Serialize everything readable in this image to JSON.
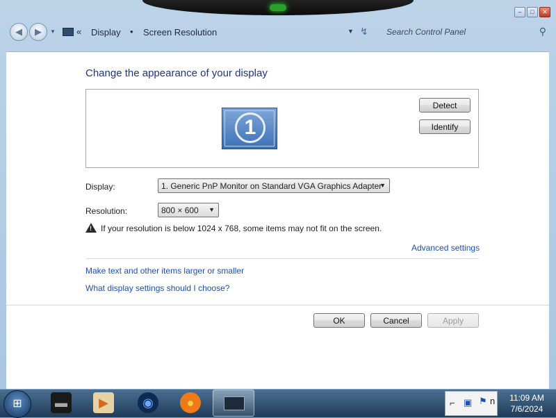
{
  "window": {
    "caption_buttons": [
      "minimize",
      "maximize",
      "close"
    ]
  },
  "address": {
    "back_icon": "back-arrow-icon",
    "forward_icon": "forward-arrow-icon",
    "overflow": "«",
    "crumbs": [
      "Display",
      "Screen Resolution"
    ],
    "separator": "•",
    "search_placeholder": "Search Control Panel"
  },
  "main": {
    "heading": "Change the appearance of your display",
    "monitor_number": "1",
    "detect_label": "Detect",
    "identify_label": "Identify",
    "display_label": "Display:",
    "display_value": "1. Generic PnP Monitor on Standard VGA Graphics Adapter",
    "resolution_label": "Resolution:",
    "resolution_value": "800 × 600",
    "warning_text": "If your resolution is below 1024 x 768, some items may not fit on the screen.",
    "advanced_link": "Advanced settings",
    "link_text_size": "Make text and other items larger or smaller",
    "link_help": "What display settings should I choose?",
    "ok_label": "OK",
    "cancel_label": "Cancel",
    "apply_label": "Apply"
  },
  "taskbar": {
    "clock_time": "11:09 AM",
    "clock_date": "7/6/2024",
    "tray_clip_text": "n"
  },
  "colors": {
    "link": "#1a4fb5",
    "heading": "#1e3287"
  }
}
